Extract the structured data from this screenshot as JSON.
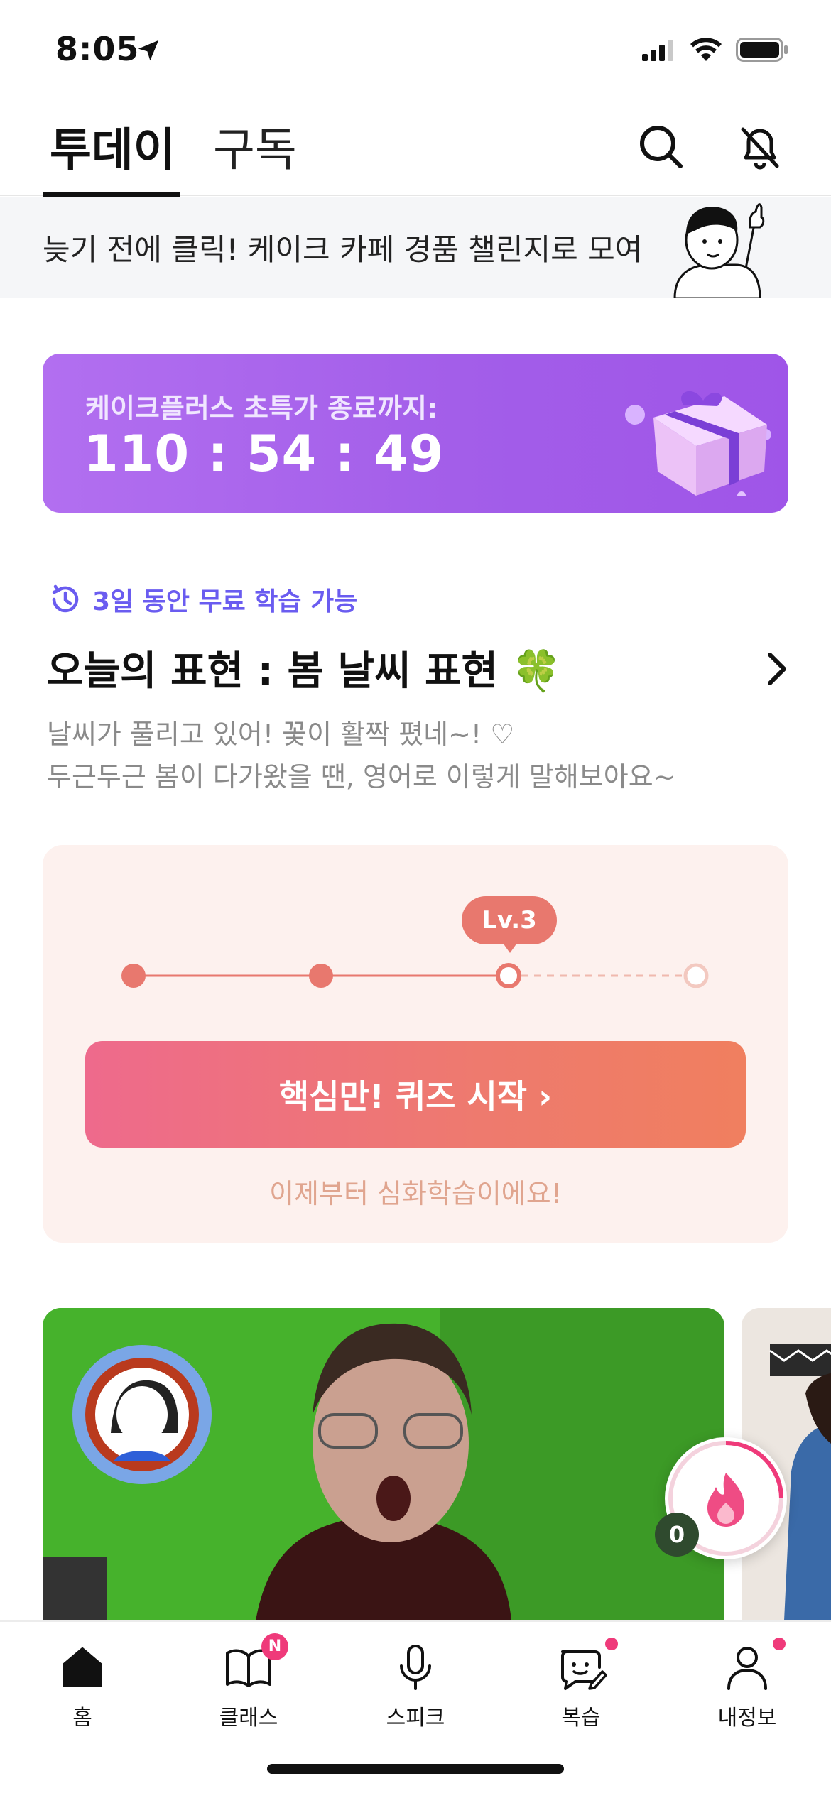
{
  "status_bar": {
    "time": "8:05"
  },
  "top_tabs": {
    "today": "투데이",
    "subscribe": "구독"
  },
  "event_banner": {
    "text": "늦기 전에 클릭! 케이크 카페 경품 챌린지로 모여라"
  },
  "promo": {
    "label": "케이크플러스 초특가 종료까지:",
    "timer": "110 : 54 : 49"
  },
  "expression": {
    "free_text": "3일 동안 무료 학습 가능",
    "title": "오늘의 표현 : 봄 날씨 표현 🍀",
    "desc_line1": "날씨가 풀리고 있어! 꽃이 활짝 폈네~! ♡",
    "desc_line2": "두근두근 봄이 다가왔을 땐, 영어로 이렇게 말해보아요~"
  },
  "level": {
    "badge": "Lv.3",
    "current_step": 3,
    "total_steps": 4,
    "quiz_button": "핵심만! 퀴즈 시작 ›",
    "hint": "이제부터 심화학습이에요!"
  },
  "fire": {
    "count": "0"
  },
  "bottom_nav": {
    "items": [
      {
        "label": "홈",
        "icon": "home-icon"
      },
      {
        "label": "클래스",
        "icon": "book-icon",
        "badge": "N"
      },
      {
        "label": "스피크",
        "icon": "microphone-icon"
      },
      {
        "label": "복습",
        "icon": "review-icon"
      },
      {
        "label": "내정보",
        "icon": "person-icon"
      }
    ]
  },
  "colors": {
    "accent_purple": "#a35ee9",
    "accent_coral": "#e8786e",
    "accent_pink": "#ef3a7a",
    "free_text_blue": "#6a5cf0"
  }
}
